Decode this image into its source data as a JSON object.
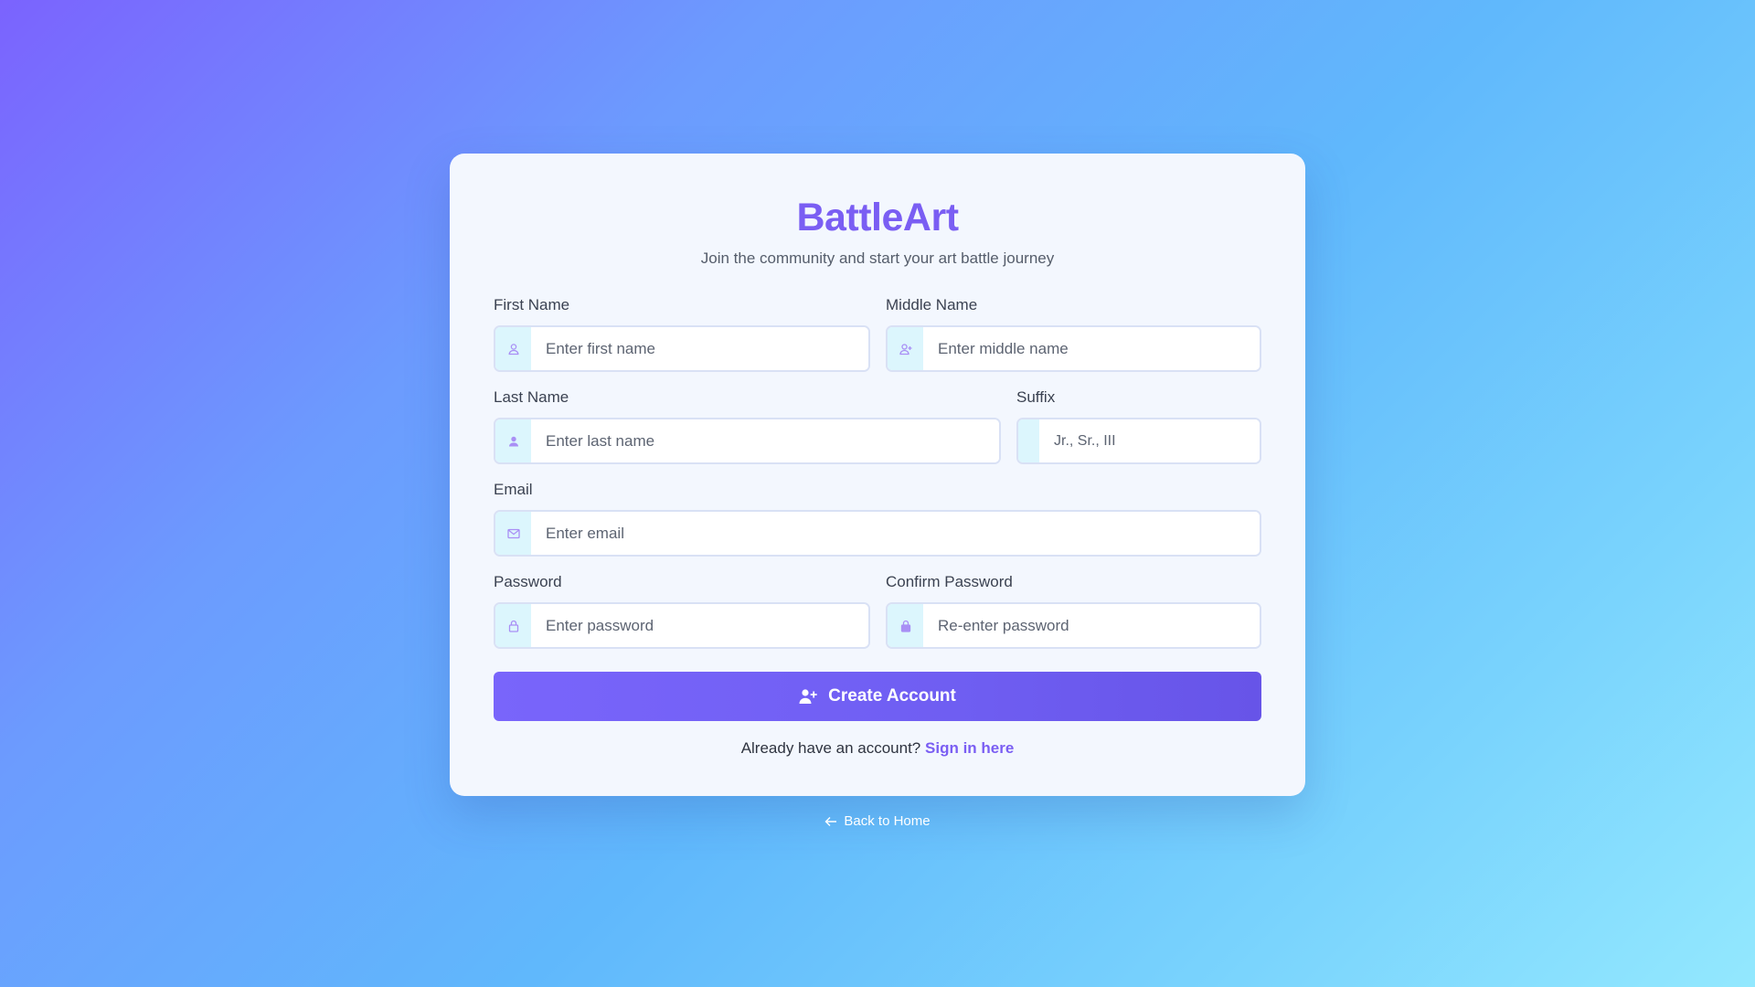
{
  "brand": {
    "name": "BattleArt",
    "tagline": "Join the community and start your art battle journey"
  },
  "form": {
    "first_name": {
      "label": "First Name",
      "placeholder": "Enter first name",
      "icon": "user-icon"
    },
    "middle_name": {
      "label": "Middle Name",
      "placeholder": "Enter middle name",
      "icon": "user-plus-icon"
    },
    "last_name": {
      "label": "Last Name",
      "placeholder": "Enter last name",
      "icon": "user-solid-icon"
    },
    "suffix": {
      "label": "Suffix",
      "placeholder": "Jr., Sr., III"
    },
    "email": {
      "label": "Email",
      "placeholder": "Enter email",
      "icon": "envelope-icon"
    },
    "password": {
      "label": "Password",
      "placeholder": "Enter password",
      "icon": "lock-icon"
    },
    "confirm_password": {
      "label": "Confirm Password",
      "placeholder": "Re-enter password",
      "icon": "lock-solid-icon"
    },
    "submit_label": "Create Account"
  },
  "signin": {
    "prompt": "Already have an account?",
    "link_label": "Sign in here"
  },
  "back_link": {
    "label": "Back to Home"
  },
  "colors": {
    "accent": "#7a5ef3",
    "button": "#7065f5",
    "icon_bg": "#dcf6fd",
    "card_bg": "#f3f7fe"
  }
}
